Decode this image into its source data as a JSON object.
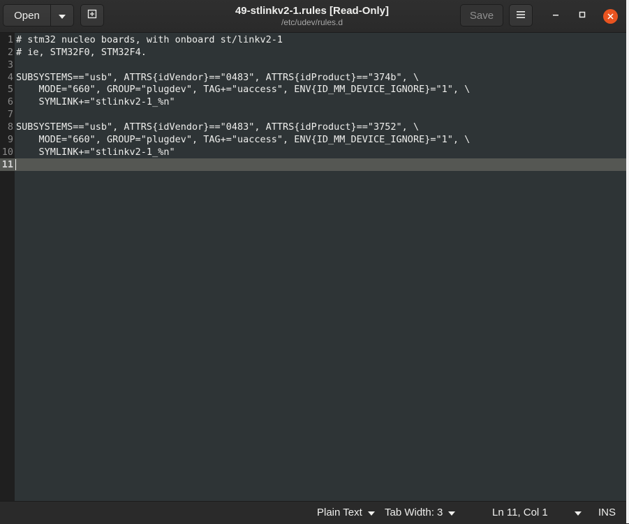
{
  "header": {
    "open_label": "Open",
    "title": "49-stlinkv2-1.rules [Read-Only]",
    "subtitle": "/etc/udev/rules.d",
    "save_label": "Save"
  },
  "editor": {
    "lines": [
      {
        "num": "1",
        "text": "# stm32 nucleo boards, with onboard st/linkv2-1"
      },
      {
        "num": "2",
        "text": "# ie, STM32F0, STM32F4."
      },
      {
        "num": "3",
        "text": ""
      },
      {
        "num": "4",
        "text": "SUBSYSTEMS==\"usb\", ATTRS{idVendor}==\"0483\", ATTRS{idProduct}==\"374b\", \\"
      },
      {
        "num": "5",
        "text": "    MODE=\"660\", GROUP=\"plugdev\", TAG+=\"uaccess\", ENV{ID_MM_DEVICE_IGNORE}=\"1\", \\"
      },
      {
        "num": "6",
        "text": "    SYMLINK+=\"stlinkv2-1_%n\""
      },
      {
        "num": "7",
        "text": ""
      },
      {
        "num": "8",
        "text": "SUBSYSTEMS==\"usb\", ATTRS{idVendor}==\"0483\", ATTRS{idProduct}==\"3752\", \\"
      },
      {
        "num": "9",
        "text": "    MODE=\"660\", GROUP=\"plugdev\", TAG+=\"uaccess\", ENV{ID_MM_DEVICE_IGNORE}=\"1\", \\"
      },
      {
        "num": "10",
        "text": "    SYMLINK+=\"stlinkv2-1_%n\""
      },
      {
        "num": "11",
        "text": ""
      }
    ],
    "current_line": 11
  },
  "status": {
    "language": "Plain Text",
    "tab_width": "Tab Width: 3",
    "position": "Ln 11, Col 1",
    "mode": "INS"
  },
  "icons": {
    "open_menu": "chevron-down-icon",
    "new_tab": "new-document-icon",
    "menu": "hamburger-menu-icon",
    "minimize": "minimize-icon",
    "maximize": "maximize-icon",
    "close": "close-icon"
  },
  "colors": {
    "editor_bg": "#2e3436",
    "current_line": "#555753",
    "close_accent": "#e95420"
  }
}
